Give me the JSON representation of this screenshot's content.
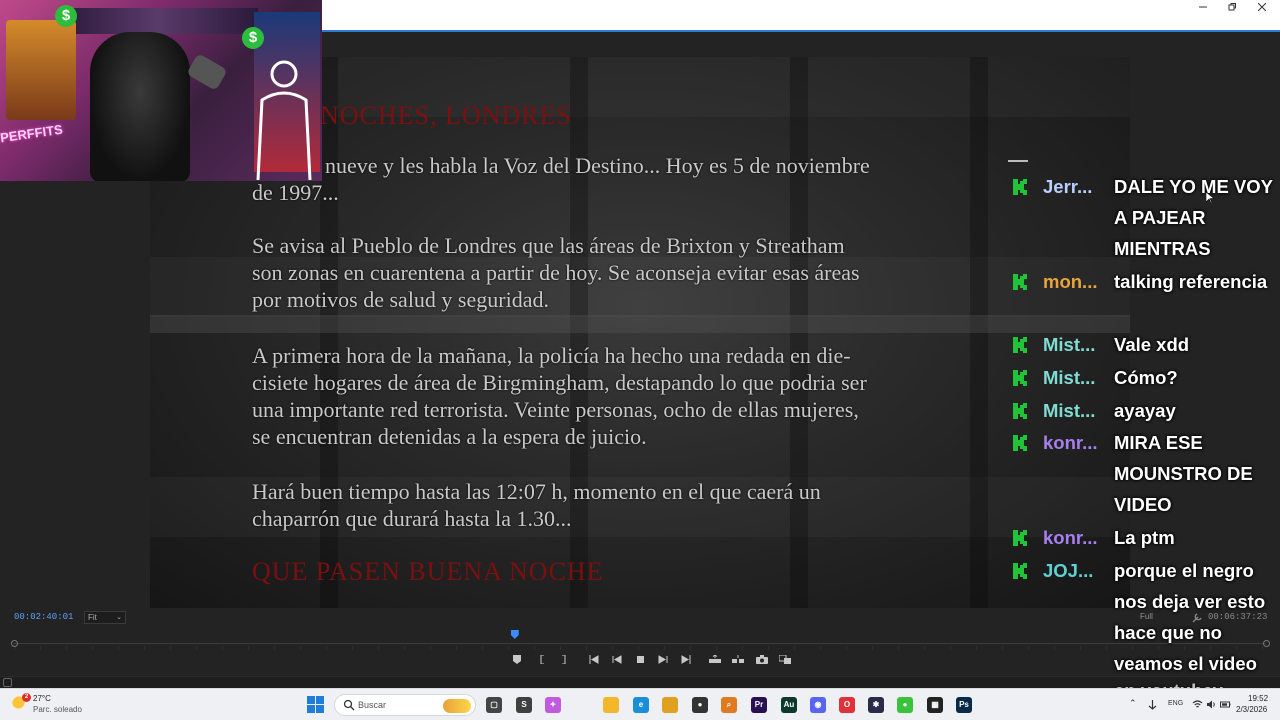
{
  "window": {
    "title": ""
  },
  "webcam": {
    "overlay_text": "PERFFITS"
  },
  "video": {
    "lines": [
      "nueve y les habla la Voz del Destino... Hoy es 5 de noviembre",
      "de 1997...",
      "Se avisa al Pueblo de Londres que las áreas de Brixton y Streatham",
      "son zonas en cuarentena a partir de hoy. Se aconseja evitar esas áreas",
      "por motivos de salud y seguridad.",
      "A primera hora de la mañana, la policía ha hecho una redada en die-",
      "cisiete hogares de área de Birgmingham, destapando lo que podria ser",
      "una importante red terrorista. Veinte personas, ocho de ellas mujeres,",
      "se encuentran detenidas a la espera de juicio.",
      "Hará buen tiempo hasta las 12:07 h, momento en el que caerá un",
      "chaparrón que durará hasta la 1.30..."
    ],
    "red_top": "NOCHES, LONDRES",
    "red_bottom": "QUE PASEN BUENA NOCHE"
  },
  "chat": {
    "colors": {
      "green_k": "#22c338",
      "white": "#ffffff"
    },
    "messages": [
      {
        "name": "Jerr...",
        "color": "#b8cfff",
        "text": "DALE YO ME VOY A PAJEAR MIENTRAS"
      },
      {
        "name": "mon...",
        "color": "#e8a43a",
        "text": "talking referencia"
      },
      {
        "name": "Mist...",
        "color": "#7fdcd2",
        "text": "Vale xdd"
      },
      {
        "name": "Mist...",
        "color": "#7fdcd2",
        "text": "Cómo?"
      },
      {
        "name": "Mist...",
        "color": "#7fdcd2",
        "text": "ayayay"
      },
      {
        "name": "konr...",
        "color": "#a77ff0",
        "text": "MIRA ESE MOUNSTRO DE VIDEO"
      },
      {
        "name": "konr...",
        "color": "#a77ff0",
        "text": "La ptm"
      },
      {
        "name": "JOJ...",
        "color": "#5ed2d2",
        "text": "porque el negro nos deja ver esto hace que no veamos el video"
      }
    ],
    "tail": "en youtubey"
  },
  "player": {
    "timecode_left": "00:02:40:01",
    "fit_label": "Fit",
    "full_label": "Full",
    "timecode_right": "00:06:37:23",
    "playhead_fraction": 0.4
  },
  "taskbar": {
    "weather_temp": "27°C",
    "weather_desc": "Parc. soleado",
    "weather_badge": "2",
    "search_placeholder": "Buscar",
    "lang": "ENG",
    "clock_time": "19:52",
    "clock_date": "2/3/2026",
    "icons": [
      {
        "name": "task-view-icon",
        "glyph": "▢",
        "color": "#444444"
      },
      {
        "name": "skype-icon",
        "glyph": "S",
        "color": "#404040"
      },
      {
        "name": "copilot-icon",
        "glyph": "✦",
        "color": "#c25ae0"
      },
      {
        "name": "file-explorer-icon",
        "glyph": "",
        "color": "#f2b72a"
      },
      {
        "name": "edge-icon",
        "glyph": "e",
        "color": "#1a8fd8"
      },
      {
        "name": "chrome-icon",
        "glyph": "",
        "color": "#e0a020"
      },
      {
        "name": "obs-icon",
        "glyph": "●",
        "color": "#333333"
      },
      {
        "name": "search-app-icon",
        "glyph": "⌕",
        "color": "#e07a20"
      },
      {
        "name": "premiere-icon",
        "glyph": "Pr",
        "color": "#2a1050"
      },
      {
        "name": "audition-icon",
        "glyph": "Au",
        "color": "#0c3a2a"
      },
      {
        "name": "discord-icon",
        "glyph": "◉",
        "color": "#5865f2"
      },
      {
        "name": "opera-icon",
        "glyph": "O",
        "color": "#e0303a"
      },
      {
        "name": "app-dark-icon",
        "glyph": "✱",
        "color": "#2a2a4a"
      },
      {
        "name": "green-app-icon",
        "glyph": "●",
        "color": "#3ac33a"
      },
      {
        "name": "terminal-icon",
        "glyph": "▦",
        "color": "#222222"
      },
      {
        "name": "photoshop-icon",
        "glyph": "Ps",
        "color": "#0a2a4a"
      }
    ]
  }
}
